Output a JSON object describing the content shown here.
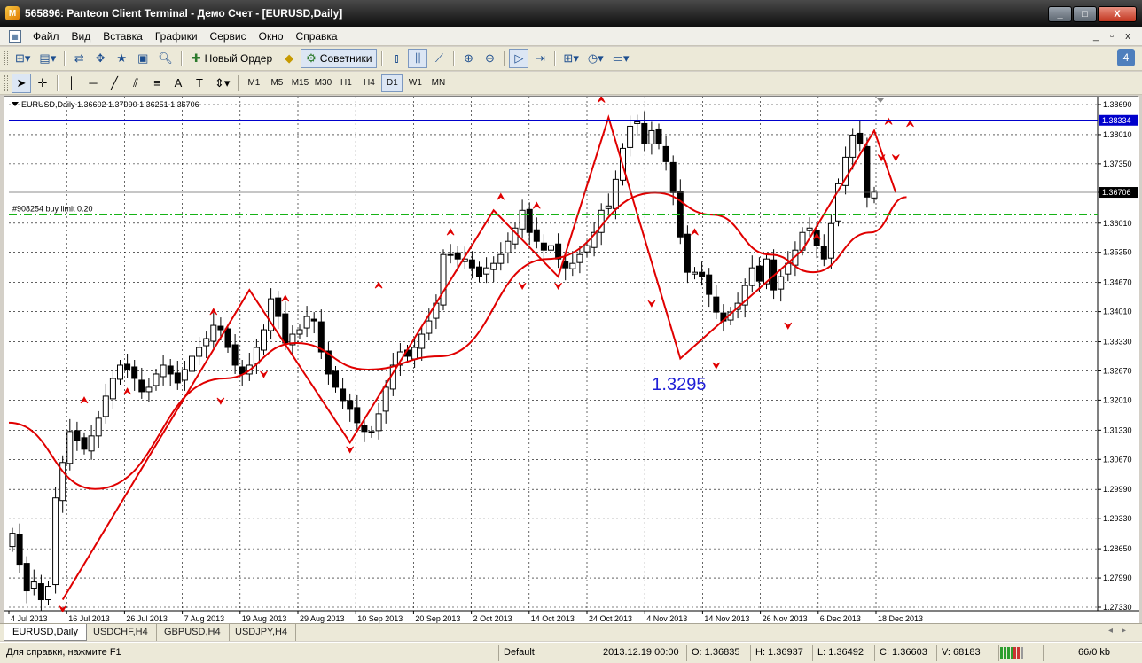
{
  "window": {
    "title": "565896: Panteon Client Terminal - Демо Счет - [EURUSD,Daily]",
    "buttons": [
      "_",
      "□",
      "X"
    ]
  },
  "menu": {
    "items": [
      "Файл",
      "Вид",
      "Вставка",
      "Графики",
      "Сервис",
      "Окно",
      "Справка"
    ],
    "mdi_buttons": [
      "_",
      "▫",
      "x"
    ]
  },
  "toolbar1": {
    "new_order_label": "Новый Ордер",
    "experts_label": "Советники",
    "expert_count": "4"
  },
  "toolbar2": {
    "text_tool": "A",
    "label_tool": "T",
    "timeframes": [
      "M1",
      "M5",
      "M15",
      "M30",
      "H1",
      "H4",
      "D1",
      "W1",
      "MN"
    ],
    "active_timeframe": "D1"
  },
  "chart_data": {
    "type": "candlestick",
    "symbol": "EURUSD",
    "timeframe": "Daily",
    "header": "EURUSD,Daily  1.36602 1.37090 1.36251 1.36706",
    "ylim": [
      1.2733,
      1.3869
    ],
    "y_ticks": [
      "1.38690",
      "1.38010",
      "1.37350",
      "1.36706",
      "1.36010",
      "1.35350",
      "1.34670",
      "1.34010",
      "1.33330",
      "1.32670",
      "1.32010",
      "1.31330",
      "1.30670",
      "1.29990",
      "1.29330",
      "1.28650",
      "1.27990",
      "1.27330"
    ],
    "x_labels": [
      "4 Jul 2013",
      "16 Jul 2013",
      "26 Jul 2013",
      "7 Aug 2013",
      "19 Aug 2013",
      "29 Aug 2013",
      "10 Sep 2013",
      "20 Sep 2013",
      "2 Oct 2013",
      "14 Oct 2013",
      "24 Oct 2013",
      "4 Nov 2013",
      "14 Nov 2013",
      "26 Nov 2013",
      "6 Dec 2013",
      "18 Dec 2013"
    ],
    "bars": 121,
    "close": [
      1.29,
      1.283,
      1.277,
      1.279,
      1.275,
      1.278,
      1.298,
      1.306,
      1.313,
      1.311,
      1.309,
      1.312,
      1.316,
      1.321,
      1.325,
      1.328,
      1.327,
      1.325,
      1.322,
      1.323,
      1.326,
      1.328,
      1.326,
      1.324,
      1.327,
      1.33,
      1.332,
      1.334,
      1.337,
      1.336,
      1.332,
      1.328,
      1.326,
      1.328,
      1.332,
      1.336,
      1.343,
      1.339,
      1.333,
      1.335,
      1.336,
      1.339,
      1.338,
      1.331,
      1.326,
      1.323,
      1.32,
      1.318,
      1.315,
      1.313,
      1.313,
      1.317,
      1.323,
      1.328,
      1.331,
      1.33,
      1.332,
      1.335,
      1.338,
      1.342,
      1.353,
      1.353,
      1.352,
      1.352,
      1.35,
      1.348,
      1.35,
      1.351,
      1.353,
      1.356,
      1.359,
      1.363,
      1.358,
      1.356,
      1.354,
      1.355,
      1.352,
      1.35,
      1.351,
      1.353,
      1.355,
      1.358,
      1.363,
      1.364,
      1.37,
      1.377,
      1.382,
      1.383,
      1.378,
      1.381,
      1.378,
      1.374,
      1.367,
      1.357,
      1.349,
      1.349,
      1.348,
      1.344,
      1.34,
      1.338,
      1.34,
      1.342,
      1.346,
      1.35,
      1.347,
      1.352,
      1.345,
      1.348,
      1.351,
      1.354,
      1.358,
      1.359,
      1.355,
      1.352,
      1.36,
      1.369,
      1.375,
      1.38,
      1.378,
      1.366,
      1.3671
    ],
    "zigzag": [
      [
        7,
        1.275
      ],
      [
        33,
        1.345
      ],
      [
        47,
        1.3105
      ],
      [
        67,
        1.363
      ],
      [
        76,
        1.348
      ],
      [
        83,
        1.384
      ],
      [
        93,
        1.3295
      ],
      [
        110,
        1.354
      ],
      [
        120,
        1.381
      ],
      [
        123,
        1.367
      ]
    ],
    "moving_average_key_points": [
      [
        0,
        1.315
      ],
      [
        12,
        1.3
      ],
      [
        30,
        1.325
      ],
      [
        40,
        1.333
      ],
      [
        50,
        1.327
      ],
      [
        60,
        1.33
      ],
      [
        75,
        1.352
      ],
      [
        90,
        1.367
      ],
      [
        98,
        1.362
      ],
      [
        106,
        1.353
      ],
      [
        112,
        1.349
      ],
      [
        120,
        1.358
      ],
      [
        125,
        1.366
      ]
    ],
    "fractals_up": [
      [
        10,
        1.319
      ],
      [
        16,
        1.321
      ],
      [
        28,
        1.339
      ],
      [
        38,
        1.342
      ],
      [
        51,
        1.345
      ],
      [
        61,
        1.357
      ],
      [
        68,
        1.365
      ],
      [
        73,
        1.363
      ],
      [
        82,
        1.387
      ],
      [
        95,
        1.357
      ],
      [
        112,
        1.356
      ],
      [
        122,
        1.382
      ],
      [
        125,
        1.3815
      ]
    ],
    "fractals_down": [
      [
        7,
        1.274
      ],
      [
        29,
        1.321
      ],
      [
        35,
        1.327
      ],
      [
        47,
        1.31
      ],
      [
        71,
        1.347
      ],
      [
        76,
        1.347
      ],
      [
        89,
        1.343
      ],
      [
        98,
        1.329
      ],
      [
        108,
        1.338
      ],
      [
        121,
        1.376
      ],
      [
        123,
        1.376
      ]
    ],
    "lines": [
      {
        "label": "",
        "price": 1.38334,
        "price_text": "1.38334",
        "style": "solid",
        "color": "#0000cc"
      },
      {
        "label": "#908254 buy limit 0.20",
        "price": 1.362,
        "price_text": "",
        "style": "dash-dot",
        "color": "#16b216"
      },
      {
        "label": "",
        "price": 1.36706,
        "price_text": "1.36706",
        "style": "solid-thin",
        "color": "#666666"
      }
    ],
    "annotation": {
      "text": "1.3295",
      "bar": 93,
      "price": 1.324,
      "color": "#1f1fd6"
    },
    "colors": {
      "candle": "#000000",
      "indicator": "#e00000",
      "grid": "#000000"
    }
  },
  "tabs": [
    "EURUSD,Daily",
    "USDCHF,H4",
    "GBPUSD,H4",
    "USDJPY,H4"
  ],
  "status": {
    "help": "Для справки, нажмите F1",
    "profile": "Default",
    "datetime": "2013.12.19 00:00",
    "open": "O: 1.36835",
    "high": "H: 1.36937",
    "low": "L: 1.36492",
    "close": "C: 1.36603",
    "volume": "V: 68183",
    "traffic": "66/0 kb"
  }
}
